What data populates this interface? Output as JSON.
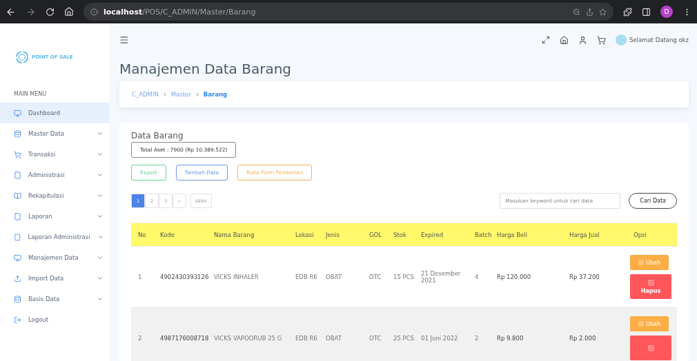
{
  "browser": {
    "url": "**localhost**/POS/C_ADMIN/Master/Barang",
    "profile_initial": "D"
  },
  "sidebar": {
    "logo": "POINT OF SALE",
    "menu_title": "MAIN MENU",
    "items": [
      {
        "label": "Dashboard",
        "selected": true,
        "expandable": false
      },
      {
        "label": "Master Data",
        "selected": false,
        "expandable": true
      },
      {
        "label": "Transaksi",
        "selected": false,
        "expandable": true
      },
      {
        "label": "Administrasi",
        "selected": false,
        "expandable": true
      },
      {
        "label": "Rekapitulasi",
        "selected": false,
        "expandable": true
      },
      {
        "label": "Laporan",
        "selected": false,
        "expandable": true
      },
      {
        "label": "Laporan Administrasi",
        "selected": false,
        "expandable": true
      },
      {
        "label": "Manajemen Data",
        "selected": false,
        "expandable": true
      },
      {
        "label": "Import Data",
        "selected": false,
        "expandable": true
      },
      {
        "label": "Basis Data",
        "selected": false,
        "expandable": true
      },
      {
        "label": "Logout",
        "selected": false,
        "expandable": false
      }
    ]
  },
  "header": {
    "greeting": "Selamat Datang okz"
  },
  "page_title": "Manajemen Data Barang",
  "breadcrumb": [
    {
      "label": "C_ADMIN",
      "selected": false
    },
    {
      "label": "Master",
      "selected": false
    },
    {
      "label": "Barang",
      "selected": true
    }
  ],
  "card": {
    "title": "Data Barang",
    "total": "Total Aset : 7900 (Rp 10.389.522)",
    "actions": [
      {
        "label": "Export",
        "color": "#5fd98c"
      },
      {
        "label": "Tambah Data",
        "color": "#6f95e8"
      },
      {
        "label": "Buka Form Pembelian",
        "color": "#f7b25c"
      }
    ],
    "pagination": [
      {
        "label": "1",
        "selected": true
      },
      {
        "label": "2",
        "selected": false
      },
      {
        "label": "3",
        "selected": false
      },
      {
        "label": "»",
        "selected": false
      },
      {
        "label": "Akhir",
        "selected": false
      }
    ],
    "search": {
      "placeholder": "Masukan keyword untuk cari data",
      "button": "Cari Data"
    }
  },
  "table": {
    "columns": [
      "No",
      "Kode",
      "Nama Barang",
      "Lokasi",
      "Jenis",
      "GOL",
      "Stok",
      "Expired",
      "Batch",
      "Harga Beli",
      "Harga Jual",
      "Opsi"
    ],
    "rows": [
      {
        "cells": [
          "1",
          "4902430393126",
          "VICKS INHALER",
          "EDB R6",
          "OBAT",
          "OTC",
          "15 PCS",
          "21 Desember 2021",
          "4",
          "Rp 120.000",
          "Rp 37.200"
        ],
        "actions": [
          {
            "kind": "edit",
            "label": "Ubah"
          },
          {
            "kind": "delete",
            "label": "Hapus"
          }
        ]
      },
      {
        "cells": [
          "2",
          "4987176008718",
          "VICKS VAPOORUB 25 G",
          "EDB R6",
          "OBAT",
          "OTC",
          "25 PCS",
          "01 Juni 2022",
          "2",
          "Rp 9.800",
          "Rp 2.000"
        ],
        "actions": [
          {
            "kind": "edit",
            "label": "Ubah"
          },
          {
            "kind": "delete"
          }
        ]
      }
    ]
  }
}
